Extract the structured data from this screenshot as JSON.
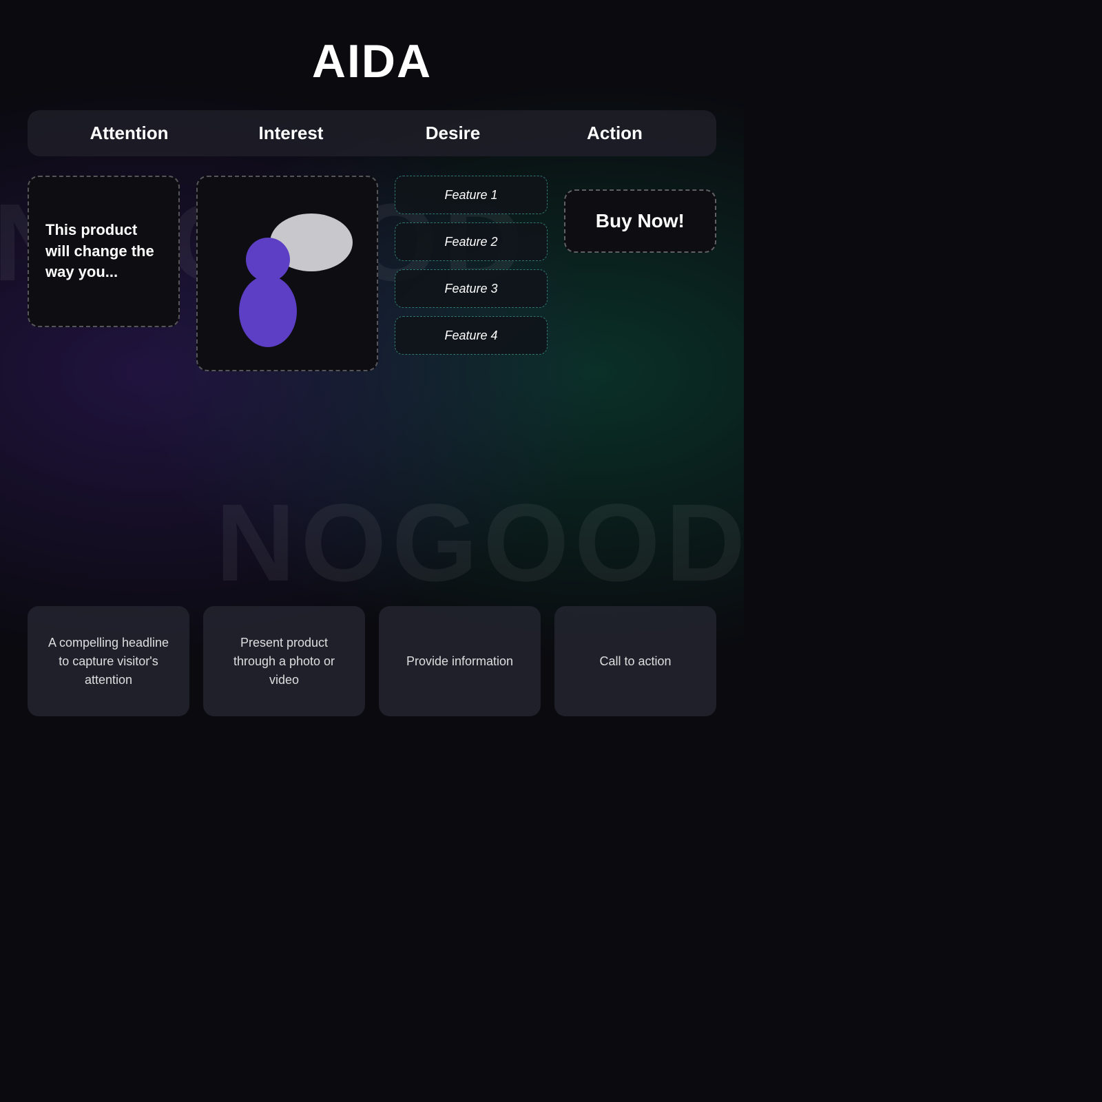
{
  "page": {
    "title": "AIDA",
    "watermark_text": "NOGOOD"
  },
  "header": {
    "columns": [
      {
        "label": "Attention"
      },
      {
        "label": "Interest"
      },
      {
        "label": "Desire"
      },
      {
        "label": "Action"
      }
    ]
  },
  "attention": {
    "card_text": "This product will change the way you..."
  },
  "interest": {
    "illustration_alt": "Person with speech bubble"
  },
  "desire": {
    "features": [
      {
        "label": "Feature 1"
      },
      {
        "label": "Feature 2"
      },
      {
        "label": "Feature 3"
      },
      {
        "label": "Feature 4"
      }
    ]
  },
  "action": {
    "button_label": "Buy Now!"
  },
  "bottom_cards": [
    {
      "text": "A compelling headline to capture visitor's attention"
    },
    {
      "text": "Present product through a photo or video"
    },
    {
      "text": "Provide information"
    },
    {
      "text": "Call to action"
    }
  ]
}
